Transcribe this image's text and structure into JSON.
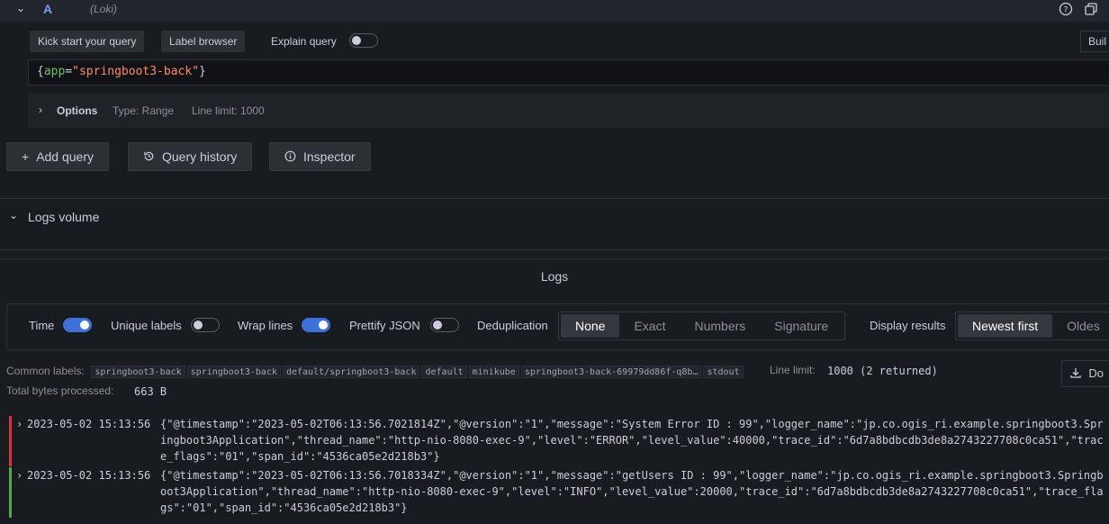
{
  "query_row": {
    "chevron": "⌄",
    "ref_id": "A",
    "datasource": "(Loki)",
    "icons": [
      "help-icon",
      "duplicate-icon"
    ]
  },
  "query_toolbar": {
    "kick_start": "Kick start your query",
    "label_browser": "Label browser",
    "explain_label": "Explain query",
    "explain_on": false,
    "builder_button": "Buil"
  },
  "editor": {
    "brace_open": "{",
    "key": "app",
    "op": "=",
    "value": "\"springboot3-back\"",
    "brace_close": "}"
  },
  "options": {
    "label": "Options",
    "type": "Type: Range",
    "line_limit": "Line limit: 1000"
  },
  "actions": {
    "add_query": "Add query",
    "query_history": "Query history",
    "inspector": "Inspector"
  },
  "logs_volume": {
    "title": "Logs volume"
  },
  "logs": {
    "title": "Logs",
    "controls": {
      "time_label": "Time",
      "time_on": true,
      "unique_labels_label": "Unique labels",
      "unique_labels_on": false,
      "wrap_lines_label": "Wrap lines",
      "wrap_lines_on": true,
      "prettify_json_label": "Prettify JSON",
      "prettify_json_on": false,
      "dedup_label": "Deduplication",
      "dedup_options": [
        "None",
        "Exact",
        "Numbers",
        "Signature"
      ],
      "dedup_selected": "None",
      "display_results_label": "Display results",
      "order_options": [
        "Newest first",
        "Oldes"
      ],
      "order_selected": "Newest first"
    },
    "common_labels_label": "Common labels:",
    "common_labels": [
      "springboot3-back",
      "springboot3-back",
      "default/springboot3-back",
      "default",
      "minikube",
      "springboot3-back-69979dd86f-q8b…",
      "stdout"
    ],
    "line_limit_label": "Line limit:",
    "line_limit_value": "1000 (2 returned)",
    "total_bytes_label": "Total bytes processed:",
    "total_bytes_value": "663 B",
    "download_label": "Do",
    "rows": [
      {
        "level": "error",
        "level_color": "#e02f44",
        "timestamp": "2023-05-02 15:13:56",
        "line": "{\"@timestamp\":\"2023-05-02T06:13:56.7021814Z\",\"@version\":\"1\",\"message\":\"System Error ID : 99\",\"logger_name\":\"jp.co.ogis_ri.example.springboot3.Springboot3Application\",\"thread_name\":\"http-nio-8080-exec-9\",\"level\":\"ERROR\",\"level_value\":40000,\"trace_id\":\"6d7a8bdbcdb3de8a2743227708c0ca51\",\"trace_flags\":\"01\",\"span_id\":\"4536ca05e2d218b3\"}"
      },
      {
        "level": "info",
        "level_color": "#56a64b",
        "timestamp": "2023-05-02 15:13:56",
        "line": "{\"@timestamp\":\"2023-05-02T06:13:56.7018334Z\",\"@version\":\"1\",\"message\":\"getUsers ID : 99\",\"logger_name\":\"jp.co.ogis_ri.example.springboot3.Springboot3Application\",\"thread_name\":\"http-nio-8080-exec-9\",\"level\":\"INFO\",\"level_value\":20000,\"trace_id\":\"6d7a8bdbcdb3de8a2743227708c0ca51\",\"trace_flags\":\"01\",\"span_id\":\"4536ca05e2d218b3\"}"
      }
    ]
  }
}
